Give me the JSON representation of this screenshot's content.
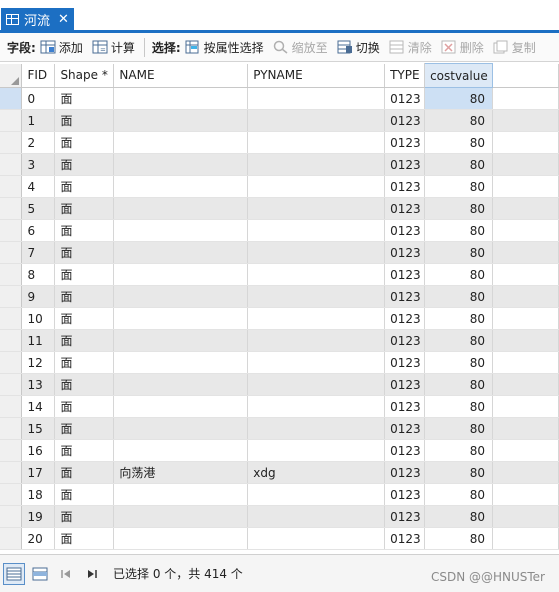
{
  "tab": {
    "title": "河流",
    "close": "✕"
  },
  "toolbar": {
    "field_label": "字段:",
    "add": "添加",
    "calculate": "计算",
    "select_label": "选择:",
    "select_by_attr": "按属性选择",
    "zoom_to": "缩放至",
    "switch": "切换",
    "clear": "清除",
    "delete": "删除",
    "copy": "复制"
  },
  "table": {
    "columns": [
      "FID",
      "Shape *",
      "NAME",
      "PYNAME",
      "TYPE",
      "costvalue"
    ],
    "rows": [
      [
        "0",
        "面",
        "",
        "",
        "0123",
        "80"
      ],
      [
        "1",
        "面",
        "",
        "",
        "0123",
        "80"
      ],
      [
        "2",
        "面",
        "",
        "",
        "0123",
        "80"
      ],
      [
        "3",
        "面",
        "",
        "",
        "0123",
        "80"
      ],
      [
        "4",
        "面",
        "",
        "",
        "0123",
        "80"
      ],
      [
        "5",
        "面",
        "",
        "",
        "0123",
        "80"
      ],
      [
        "6",
        "面",
        "",
        "",
        "0123",
        "80"
      ],
      [
        "7",
        "面",
        "",
        "",
        "0123",
        "80"
      ],
      [
        "8",
        "面",
        "",
        "",
        "0123",
        "80"
      ],
      [
        "9",
        "面",
        "",
        "",
        "0123",
        "80"
      ],
      [
        "10",
        "面",
        "",
        "",
        "0123",
        "80"
      ],
      [
        "11",
        "面",
        "",
        "",
        "0123",
        "80"
      ],
      [
        "12",
        "面",
        "",
        "",
        "0123",
        "80"
      ],
      [
        "13",
        "面",
        "",
        "",
        "0123",
        "80"
      ],
      [
        "14",
        "面",
        "",
        "",
        "0123",
        "80"
      ],
      [
        "15",
        "面",
        "",
        "",
        "0123",
        "80"
      ],
      [
        "16",
        "面",
        "",
        "",
        "0123",
        "80"
      ],
      [
        "17",
        "面",
        "向荡港",
        "xdg",
        "0123",
        "80"
      ],
      [
        "18",
        "面",
        "",
        "",
        "0123",
        "80"
      ],
      [
        "19",
        "面",
        "",
        "",
        "0123",
        "80"
      ],
      [
        "20",
        "面",
        "",
        "",
        "0123",
        "80"
      ]
    ]
  },
  "status": {
    "text": "已选择 0 个，共 414 个"
  },
  "watermark": "CSDN @@HNUSTer",
  "colors": {
    "accent": "#1c6fc3",
    "selected_cell": "#cde0f4",
    "alt_row": "#e8e8e8"
  }
}
